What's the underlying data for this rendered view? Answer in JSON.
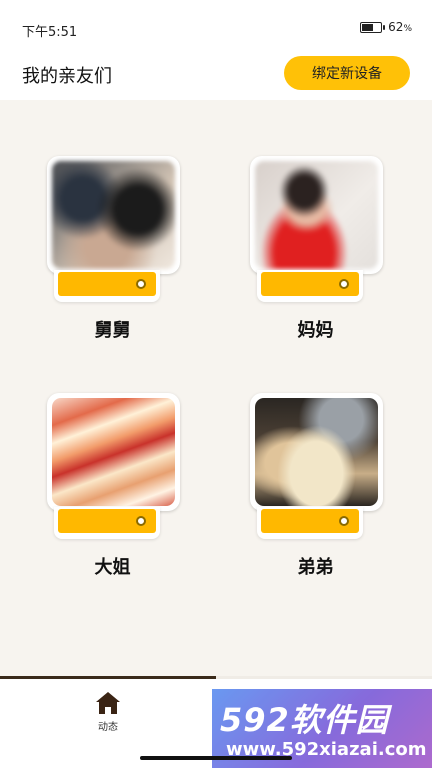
{
  "status_bar": {
    "time": "下午5:51",
    "battery_percent": "62",
    "battery_unit": "%",
    "battery_level": 0.62
  },
  "header": {
    "title": "我的亲友们",
    "bind_button_label": "绑定新设备"
  },
  "devices": [
    {
      "name": "舅舅",
      "photo": "blurred-person-photo"
    },
    {
      "name": "妈妈",
      "photo": "blurred-child-photo"
    },
    {
      "name": "大姐",
      "photo": "abstract-light-streaks"
    },
    {
      "name": "弟弟",
      "photo": "open-book-photo"
    }
  ],
  "tabbar": {
    "tabs": [
      {
        "label": "动态",
        "icon": "home-icon",
        "active": true
      }
    ]
  },
  "watermark": {
    "title": "592软件园",
    "url": "www.592xiazai.com"
  },
  "colors": {
    "accent": "#ffc107",
    "stand": "#ffb800",
    "background": "#f7f4ef",
    "tab_indicator": "#3a2a1a"
  }
}
